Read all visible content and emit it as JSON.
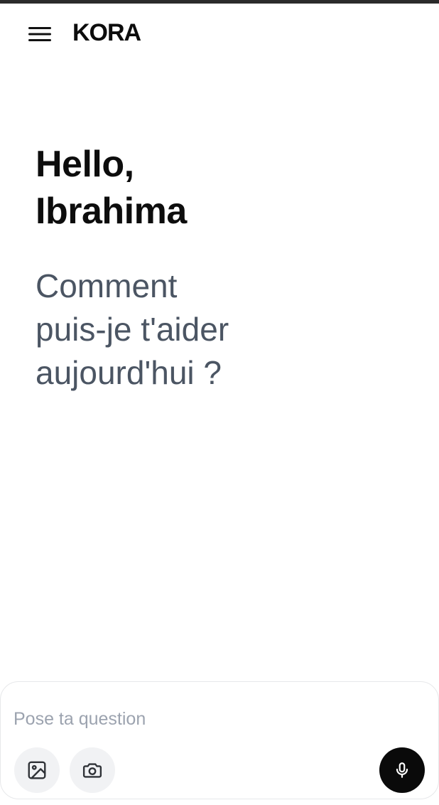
{
  "header": {
    "title": "KORA",
    "menu_icon": "hamburger-menu-icon"
  },
  "greeting": {
    "line1": "Hello,",
    "line2": "Ibrahima"
  },
  "subtitle": {
    "line1": "Comment",
    "line2": "puis-je t'aider",
    "line3": "aujourd'hui ?"
  },
  "composer": {
    "placeholder": "Pose ta question",
    "value": "",
    "image_icon": "image-icon",
    "camera_icon": "camera-icon",
    "mic_icon": "microphone-icon"
  },
  "colors": {
    "background": "#ffffff",
    "text_primary": "#0d0d0d",
    "text_secondary": "#4b5563",
    "placeholder": "#9ca3af",
    "tool_button_bg": "#f1f2f4",
    "mic_button_bg": "#0a0a0a"
  }
}
